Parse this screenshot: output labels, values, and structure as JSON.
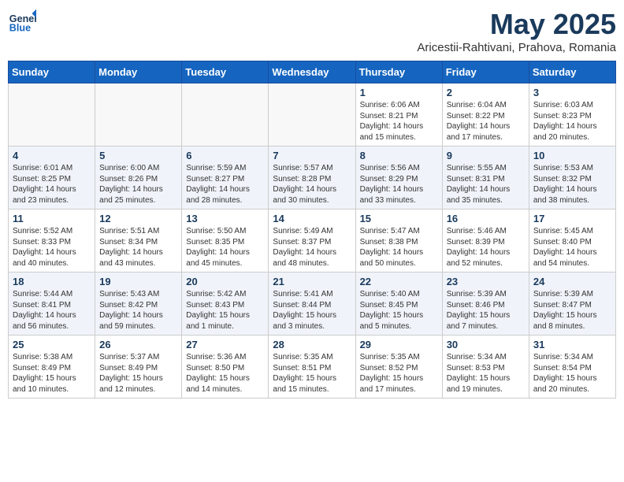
{
  "logo": {
    "line1": "General",
    "line2": "Blue"
  },
  "title": "May 2025",
  "subtitle": "Aricestii-Rahtivani, Prahova, Romania",
  "weekdays": [
    "Sunday",
    "Monday",
    "Tuesday",
    "Wednesday",
    "Thursday",
    "Friday",
    "Saturday"
  ],
  "weeks": [
    [
      {
        "day": "",
        "info": ""
      },
      {
        "day": "",
        "info": ""
      },
      {
        "day": "",
        "info": ""
      },
      {
        "day": "",
        "info": ""
      },
      {
        "day": "1",
        "info": "Sunrise: 6:06 AM\nSunset: 8:21 PM\nDaylight: 14 hours\nand 15 minutes."
      },
      {
        "day": "2",
        "info": "Sunrise: 6:04 AM\nSunset: 8:22 PM\nDaylight: 14 hours\nand 17 minutes."
      },
      {
        "day": "3",
        "info": "Sunrise: 6:03 AM\nSunset: 8:23 PM\nDaylight: 14 hours\nand 20 minutes."
      }
    ],
    [
      {
        "day": "4",
        "info": "Sunrise: 6:01 AM\nSunset: 8:25 PM\nDaylight: 14 hours\nand 23 minutes."
      },
      {
        "day": "5",
        "info": "Sunrise: 6:00 AM\nSunset: 8:26 PM\nDaylight: 14 hours\nand 25 minutes."
      },
      {
        "day": "6",
        "info": "Sunrise: 5:59 AM\nSunset: 8:27 PM\nDaylight: 14 hours\nand 28 minutes."
      },
      {
        "day": "7",
        "info": "Sunrise: 5:57 AM\nSunset: 8:28 PM\nDaylight: 14 hours\nand 30 minutes."
      },
      {
        "day": "8",
        "info": "Sunrise: 5:56 AM\nSunset: 8:29 PM\nDaylight: 14 hours\nand 33 minutes."
      },
      {
        "day": "9",
        "info": "Sunrise: 5:55 AM\nSunset: 8:31 PM\nDaylight: 14 hours\nand 35 minutes."
      },
      {
        "day": "10",
        "info": "Sunrise: 5:53 AM\nSunset: 8:32 PM\nDaylight: 14 hours\nand 38 minutes."
      }
    ],
    [
      {
        "day": "11",
        "info": "Sunrise: 5:52 AM\nSunset: 8:33 PM\nDaylight: 14 hours\nand 40 minutes."
      },
      {
        "day": "12",
        "info": "Sunrise: 5:51 AM\nSunset: 8:34 PM\nDaylight: 14 hours\nand 43 minutes."
      },
      {
        "day": "13",
        "info": "Sunrise: 5:50 AM\nSunset: 8:35 PM\nDaylight: 14 hours\nand 45 minutes."
      },
      {
        "day": "14",
        "info": "Sunrise: 5:49 AM\nSunset: 8:37 PM\nDaylight: 14 hours\nand 48 minutes."
      },
      {
        "day": "15",
        "info": "Sunrise: 5:47 AM\nSunset: 8:38 PM\nDaylight: 14 hours\nand 50 minutes."
      },
      {
        "day": "16",
        "info": "Sunrise: 5:46 AM\nSunset: 8:39 PM\nDaylight: 14 hours\nand 52 minutes."
      },
      {
        "day": "17",
        "info": "Sunrise: 5:45 AM\nSunset: 8:40 PM\nDaylight: 14 hours\nand 54 minutes."
      }
    ],
    [
      {
        "day": "18",
        "info": "Sunrise: 5:44 AM\nSunset: 8:41 PM\nDaylight: 14 hours\nand 56 minutes."
      },
      {
        "day": "19",
        "info": "Sunrise: 5:43 AM\nSunset: 8:42 PM\nDaylight: 14 hours\nand 59 minutes."
      },
      {
        "day": "20",
        "info": "Sunrise: 5:42 AM\nSunset: 8:43 PM\nDaylight: 15 hours\nand 1 minute."
      },
      {
        "day": "21",
        "info": "Sunrise: 5:41 AM\nSunset: 8:44 PM\nDaylight: 15 hours\nand 3 minutes."
      },
      {
        "day": "22",
        "info": "Sunrise: 5:40 AM\nSunset: 8:45 PM\nDaylight: 15 hours\nand 5 minutes."
      },
      {
        "day": "23",
        "info": "Sunrise: 5:39 AM\nSunset: 8:46 PM\nDaylight: 15 hours\nand 7 minutes."
      },
      {
        "day": "24",
        "info": "Sunrise: 5:39 AM\nSunset: 8:47 PM\nDaylight: 15 hours\nand 8 minutes."
      }
    ],
    [
      {
        "day": "25",
        "info": "Sunrise: 5:38 AM\nSunset: 8:49 PM\nDaylight: 15 hours\nand 10 minutes."
      },
      {
        "day": "26",
        "info": "Sunrise: 5:37 AM\nSunset: 8:49 PM\nDaylight: 15 hours\nand 12 minutes."
      },
      {
        "day": "27",
        "info": "Sunrise: 5:36 AM\nSunset: 8:50 PM\nDaylight: 15 hours\nand 14 minutes."
      },
      {
        "day": "28",
        "info": "Sunrise: 5:35 AM\nSunset: 8:51 PM\nDaylight: 15 hours\nand 15 minutes."
      },
      {
        "day": "29",
        "info": "Sunrise: 5:35 AM\nSunset: 8:52 PM\nDaylight: 15 hours\nand 17 minutes."
      },
      {
        "day": "30",
        "info": "Sunrise: 5:34 AM\nSunset: 8:53 PM\nDaylight: 15 hours\nand 19 minutes."
      },
      {
        "day": "31",
        "info": "Sunrise: 5:34 AM\nSunset: 8:54 PM\nDaylight: 15 hours\nand 20 minutes."
      }
    ]
  ]
}
